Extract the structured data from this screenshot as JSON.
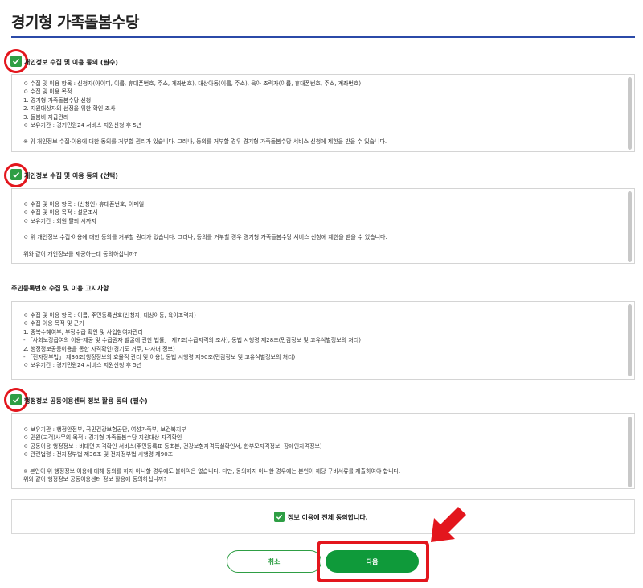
{
  "header": {
    "title": "경기형 가족돌봄수당"
  },
  "sections": [
    {
      "title": "개인정보 수집 및 이용 동의 (필수)",
      "checked": true,
      "lines": [
        "ㅇ 수집 및 이용 항목 : 신청자(아이디, 이름, 휴대폰번호, 주소, 계좌번호), 대상아동(이름, 주소), 육아 조력자(이름, 휴대폰번호, 주소, 계좌번호)",
        "ㅇ 수집 및 이용 목적",
        " 1. 경기형 가족돌봄수당 신청",
        " 2. 지원대상자의 선정을 위한 확인 조사",
        " 3. 돌봄비 지급관리",
        "ㅇ 보유기간 : 경기민원24 서비스 지원신청 후 5년",
        "",
        "※ 위 개인정보 수집·이용에 대한 동의를 거부할 권리가 있습니다. 그러나, 동의를 거부할 경우 경기형 가족돌봄수당 서비스 신청에 제한을 받을 수 있습니다."
      ]
    },
    {
      "title": "개인정보 수집 및 이용 동의 (선택)",
      "checked": true,
      "lines": [
        "ㅇ 수집 및 이용 항목 : (신청인) 휴대폰번호, 이메일",
        "ㅇ 수집 및 이용 목적 : 설문조사",
        "ㅇ 보유기간 : 회원 탈퇴 시까지",
        "",
        "ㅇ 위 개인정보 수집·이용에 대한 동의를 거부할 권리가 있습니다. 그러나, 동의를 거부할 경우 경기형 가족돌봄수당 서비스 신청에 제한을 받을 수 있습니다.",
        "",
        "위와 같이 개인정보를 제공하는데 동의하십니까?"
      ]
    },
    {
      "title": "주민등록번호 수집 및 이용 고지사항",
      "checked": false,
      "lines": [
        "ㅇ 수집 및 이용 항목 : 이름, 주민등록번호(신청자, 대상아동, 육아조력자)",
        "ㅇ 수집·이용 목적 및 근거",
        "1. 중복수혜여부, 부정수급 확인 및 사업참여자관리",
        " - 「사회보장급여의 이용·제공 및 수급권자 발굴에 관한 법률」 제7조(수급자격의 조사), 동법 시행령 제28조(민감정보 및 고유식별정보의 처리)",
        "2. 행정정보공동이용을 통한 자격확인(경기도 거주, 다자녀 정보)",
        " - 「전자정부법」 제36조(행정정보의 효율적 관리 및 이용), 동법 시행령 제90조(민감정보 및 고유식별정보의 처리)",
        "ㅇ 보유기간 : 경기민원24 서비스 지원신청 후 5년"
      ]
    },
    {
      "title": "행정정보 공동이용센터 정보 활용 동의 (필수)",
      "checked": true,
      "lines": [
        "ㅇ 보유기관 : 행정안전부, 국민건강보험공단, 여성가족부, 보건복지부",
        "ㅇ 민원(고객)사무의 목적 : 경기형 가족돌봄수당 지원대상 자격확인",
        "ㅇ 공동이용 행정정보 : 비대면 자격확인 서비스(주민등록표 등초본, 건강보험자격득실확인서, 한부모자격정보, 장애인자격정보)",
        "ㅇ 관련법령 : 전자정부법 제36조 및 전자정부법 시행령 제90조",
        "",
        "※ 본인이 위 행정정보 이용에 대해 동의를 하지 아니할 경우에도 불이익은 없습니다. 다만, 동의하지 아니한 경우에는 본인이 해당 구비서류를 제출하여야 합니다.",
        "위와 같이 행정정보 공동이용센터 정보 활용에 동의하십니까?"
      ]
    }
  ],
  "agree_all": {
    "label": "정보 이용에 전체 동의합니다.",
    "checked": true
  },
  "buttons": {
    "cancel": "취소",
    "next": "다음"
  },
  "colors": {
    "accent_green": "#2e9e44",
    "button_green": "#0f9a3a",
    "highlight_red": "#e3161d",
    "title_rule": "#2b4aa8"
  }
}
